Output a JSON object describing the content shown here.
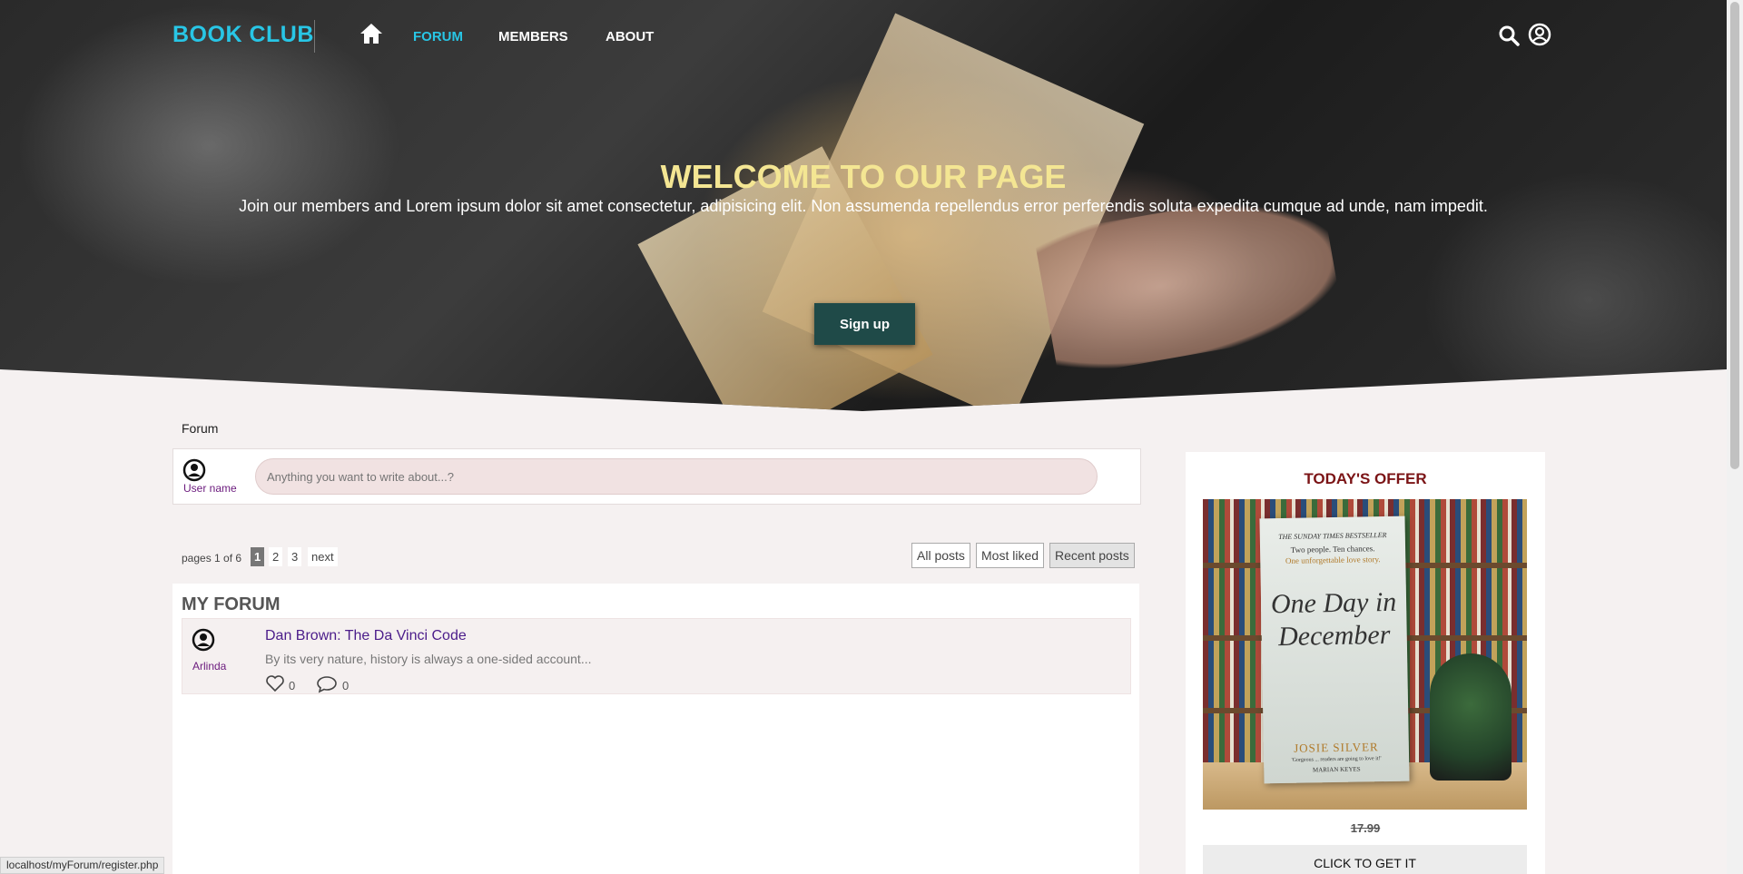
{
  "nav": {
    "brand": "BOOK CLUB",
    "links": [
      "FORUM",
      "MEMBERS",
      "ABOUT"
    ],
    "icons": {
      "home": "home-icon",
      "search": "search-icon",
      "user": "user-circle-icon"
    },
    "accent_color": "#28c6e6"
  },
  "hero": {
    "title": "WELCOME TO OUR PAGE",
    "subtitle": "Join our members and Lorem ipsum dolor sit amet consectetur, adipisicing elit. Non assumenda repellendus error perferendis soluta expedita cumque ad unde, nam impedit.",
    "signup_label": "Sign up",
    "title_color": "#f4e693"
  },
  "breadcrumb": "Forum",
  "composer": {
    "user_name": "User name",
    "placeholder": "Anything you want to write about...?"
  },
  "pager": {
    "info": "pages 1 of 6",
    "pages": [
      "1",
      "2",
      "3"
    ],
    "current": "1",
    "next_label": "next"
  },
  "filters": [
    "All posts",
    "Most liked",
    "Recent posts"
  ],
  "forum": {
    "title": "MY FORUM",
    "posts": [
      {
        "author": "Arlinda",
        "title": "Dan Brown: The Da Vinci Code",
        "excerpt": "By its very nature, history is always a one-sided account...",
        "likes": "0",
        "comments": "0"
      }
    ]
  },
  "offer": {
    "title": "TODAY'S OFFER",
    "book": {
      "top_line": "THE SUNDAY TIMES BESTSELLER",
      "tagline1": "Two people. Ten chances.",
      "tagline2": "One unforgettable love story.",
      "title_line1": "One Day in",
      "title_line2": "December",
      "author": "JOSIE SILVER",
      "blurb": "'Gorgeous ... readers are going to love it!'",
      "blurb_author": "MARIAN KEYES"
    },
    "price": "17.99",
    "cta": "CLICK TO GET IT",
    "title_color": "#7b1416"
  },
  "status_bar": "localhost/myForum/register.php"
}
